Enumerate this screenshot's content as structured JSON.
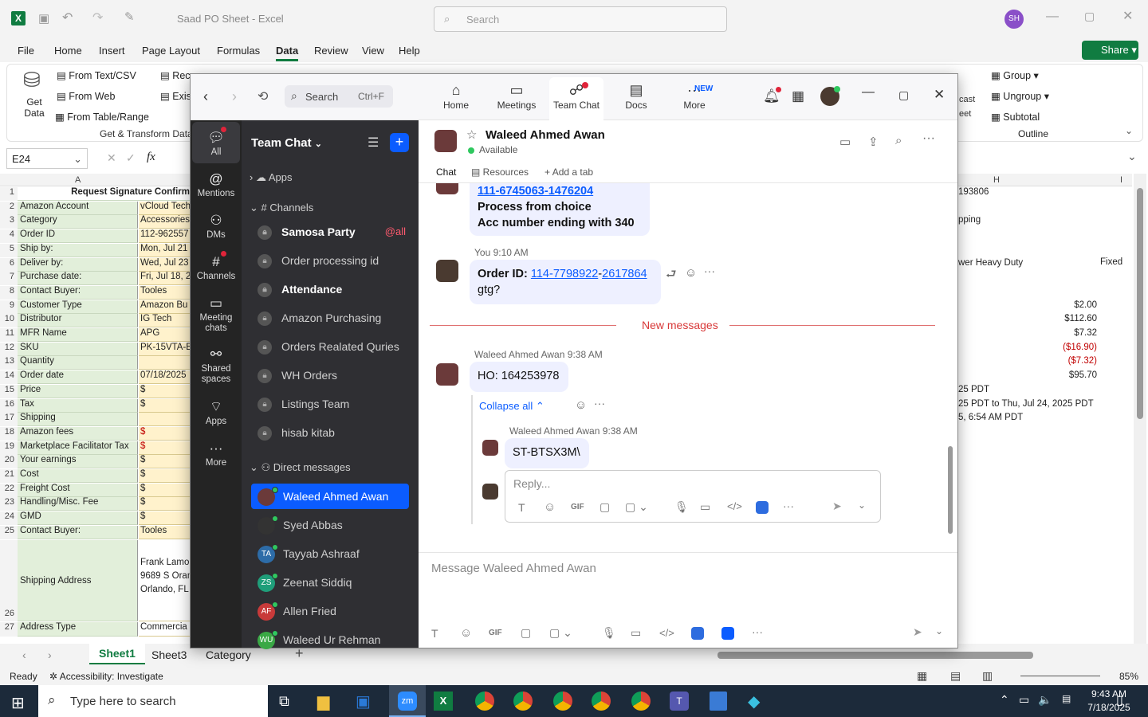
{
  "excel": {
    "title": "Saad PO Sheet  -  Excel",
    "search_placeholder": "Search",
    "user_initials": "SH",
    "tabs": [
      "File",
      "Home",
      "Insert",
      "Page Layout",
      "Formulas",
      "Data",
      "Review",
      "View",
      "Help"
    ],
    "active_tab": "Data",
    "share_label": "Share",
    "ribbon": {
      "get_data": "Get Data",
      "from_text": "From Text/CSV",
      "from_web": "From Web",
      "from_table": "From Table/Range",
      "rec_partial": "Rec",
      "exis_partial": "Exis",
      "group_label": "Get & Transform Data",
      "group_btn": "Group",
      "ungroup_btn": "Ungroup",
      "subtotal_btn": "Subtotal",
      "outline_label": "Outline",
      "cast_partial": "cast",
      "eet_partial": "eet"
    },
    "name_box": "E24",
    "fx": "fx",
    "col_a": "A",
    "col_h": "H",
    "col_i": "I",
    "rows": [
      {
        "n": "1",
        "a": "Request Signature Confirm",
        "b": "",
        "h": "193806"
      },
      {
        "n": "2",
        "a": "Amazon Account",
        "b": "vCloud Tech",
        "h": ""
      },
      {
        "n": "3",
        "a": "Category",
        "b": "Accessories",
        "h": "pping"
      },
      {
        "n": "4",
        "a": "Order ID",
        "b": "112-962557",
        "h": ""
      },
      {
        "n": "5",
        "a": "Ship by:",
        "b": "Mon, Jul 21",
        "h": ""
      },
      {
        "n": "6",
        "a": "Deliver by:",
        "b": "Wed, Jul 23",
        "h": "wer Heavy Duty"
      },
      {
        "n": "7",
        "a": "Purchase date:",
        "b": "Fri, Jul 18, 2",
        "h": ""
      },
      {
        "n": "8",
        "a": "Contact Buyer:",
        "b": "Tooles",
        "h": ""
      },
      {
        "n": "9",
        "a": "Customer Type",
        "b": "Amazon Bu",
        "h": "$2.00"
      },
      {
        "n": "10",
        "a": "Distributor",
        "b": "IG Tech",
        "h": "$112.60"
      },
      {
        "n": "11",
        "a": "MFR Name",
        "b": "APG",
        "h": "$7.32"
      },
      {
        "n": "12",
        "a": "SKU",
        "b": "PK-15VTA-B",
        "h": "($16.90)"
      },
      {
        "n": "13",
        "a": "Quantity",
        "b": "",
        "h": "($7.32)"
      },
      {
        "n": "14",
        "a": "Order date",
        "b": "07/18/2025",
        "h": "$95.70"
      },
      {
        "n": "15",
        "a": "Price",
        "b": "$",
        "h": "25 PDT"
      },
      {
        "n": "16",
        "a": "Tax",
        "b": "$",
        "h": "25 PDT to Thu, Jul 24, 2025 PDT"
      },
      {
        "n": "17",
        "a": "Shipping",
        "b": "",
        "h": "5, 6:54 AM PDT"
      },
      {
        "n": "18",
        "a": "Amazon fees",
        "b": "$",
        "h": ""
      },
      {
        "n": "19",
        "a": "Marketplace Facilitator Tax",
        "b": "$",
        "h": ""
      },
      {
        "n": "20",
        "a": "Your earnings",
        "b": "$",
        "h": ""
      },
      {
        "n": "21",
        "a": "Cost",
        "b": "$",
        "h": ""
      },
      {
        "n": "22",
        "a": "Freight Cost",
        "b": "$",
        "h": ""
      },
      {
        "n": "23",
        "a": "Handling/Misc. Fee",
        "b": "$",
        "h": ""
      },
      {
        "n": "24",
        "a": "GMD",
        "b": "$",
        "h": ""
      },
      {
        "n": "25",
        "a": "Contact Buyer:",
        "b": "Tooles",
        "h": ""
      }
    ],
    "i6": "Fixed",
    "row26": {
      "n": "26",
      "a": "Shipping Address",
      "b1": "Frank Lamo",
      "b2": "9689 S Oran",
      "b3": "Orlando, FL"
    },
    "row27": {
      "n": "27",
      "a": "Address Type",
      "b": "Commercia"
    },
    "sheets": [
      "Sheet1",
      "Sheet3",
      "Category"
    ],
    "status_ready": "Ready",
    "accessibility": "Accessibility: Investigate",
    "zoom_pct": "85%"
  },
  "zoom": {
    "search_label": "Search",
    "search_shortcut": "Ctrl+F",
    "nav": [
      "Home",
      "Meetings",
      "Team Chat",
      "Docs",
      "More"
    ],
    "new_badge": "NEW",
    "rail": [
      "All",
      "Mentions",
      "DMs",
      "Channels",
      "Meeting chats",
      "Shared spaces",
      "Apps",
      "More"
    ],
    "sidebar_title": "Team Chat",
    "apps_label": "Apps",
    "channels_label": "Channels",
    "channels": [
      {
        "name": "Samosa Party",
        "bold": true,
        "tag": "@all"
      },
      {
        "name": "Order processing id",
        "bold": false,
        "tag": ""
      },
      {
        "name": "Attendance",
        "bold": true,
        "tag": ""
      },
      {
        "name": "Amazon Purchasing",
        "bold": false,
        "tag": ""
      },
      {
        "name": "Orders Realated Quries",
        "bold": false,
        "tag": ""
      },
      {
        "name": "WH Orders",
        "bold": false,
        "tag": ""
      },
      {
        "name": "Listings Team",
        "bold": false,
        "tag": ""
      },
      {
        "name": "hisab kitab",
        "bold": false,
        "tag": ""
      }
    ],
    "dm_label": "Direct messages",
    "dms": [
      {
        "name": "Waleed Ahmed Awan",
        "initials": "",
        "color": "#6b3a3a"
      },
      {
        "name": "Syed Abbas",
        "initials": "",
        "color": "#333"
      },
      {
        "name": "Tayyab Ashraaf",
        "initials": "TA",
        "color": "#2d6ca8"
      },
      {
        "name": "Zeenat Siddiq",
        "initials": "ZS",
        "color": "#1f9e7a"
      },
      {
        "name": "Allen Fried",
        "initials": "AF",
        "color": "#c83a3a"
      },
      {
        "name": "Waleed Ur Rehman",
        "initials": "WU",
        "color": "#3aa845"
      }
    ],
    "contact_name": "Waleed Ahmed Awan",
    "contact_status": "Available",
    "chat_tabs": [
      "Chat",
      "Resources",
      "Add a tab"
    ],
    "msg_prev_link": "111-6745063-1476204",
    "msg_prev_l2": "Process from choice",
    "msg_prev_l3": "Acc number ending with 340",
    "you_meta": "You 9:10 AM",
    "order_label": "Order ID: ",
    "order_link1": "114-7798922",
    "order_dash": "-",
    "order_link2": "2617864",
    "gtg": "gtg?",
    "new_messages": "New messages",
    "waleed_meta": "Waleed Ahmed Awan",
    "waleed_time": "9:38 AM",
    "ho_msg": "HO: 164253978",
    "collapse_all": "Collapse all",
    "reply_meta": "Waleed Ahmed Awan",
    "reply_time": "9:38 AM",
    "reply_msg": "ST-BTSX3M\\",
    "reply_placeholder": "Reply...",
    "message_placeholder": "Message Waleed Ahmed Awan",
    "gif": "GIF"
  },
  "taskbar": {
    "search_placeholder": "Type here to search",
    "time": "9:43 AM",
    "date": "7/18/2025"
  }
}
